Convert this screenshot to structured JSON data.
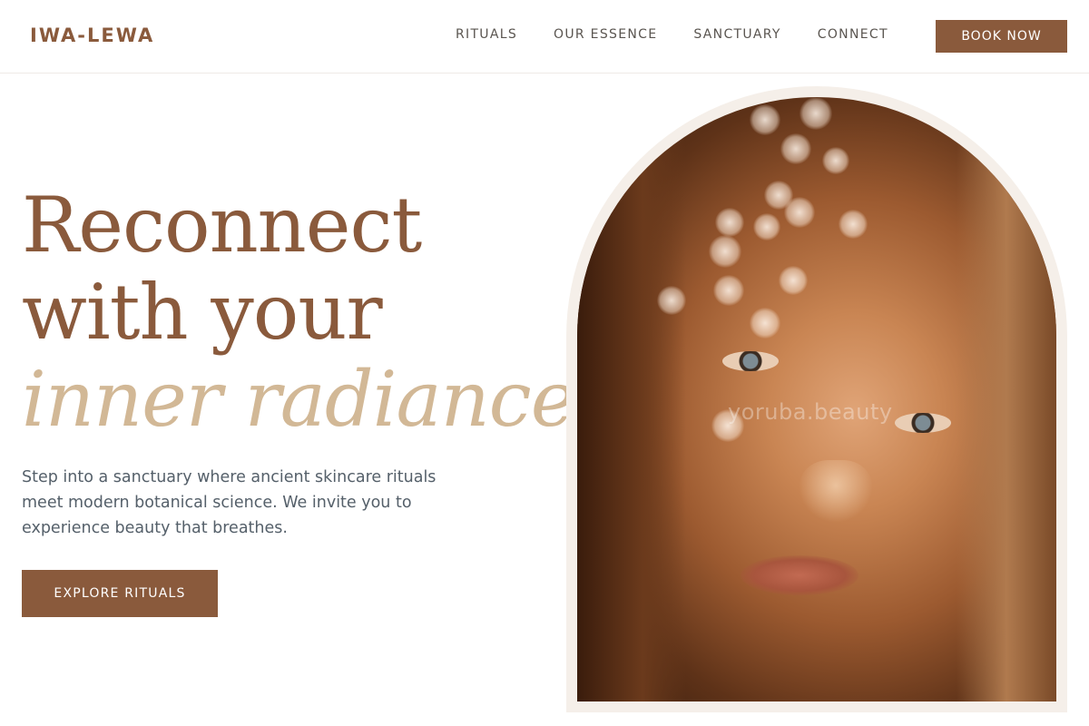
{
  "header": {
    "logo": "IWA-LEWA",
    "nav": [
      "RITUALS",
      "OUR ESSENCE",
      "SANCTUARY",
      "CONNECT"
    ],
    "cta": "BOOK NOW"
  },
  "hero": {
    "headline_line1": "Reconnect",
    "headline_line2": "with your",
    "headline_line3": "inner radiance.",
    "lede": "Step into a sanctuary where ancient skincare rituals meet modern botanical science. We invite you to experience beauty that breathes.",
    "cta": "EXPLORE RITUALS",
    "image_watermark": "yoruba.beauty"
  },
  "colors": {
    "brand": "#8a5a3c",
    "accent": "#d2b896",
    "frame": "#f5efe9"
  }
}
